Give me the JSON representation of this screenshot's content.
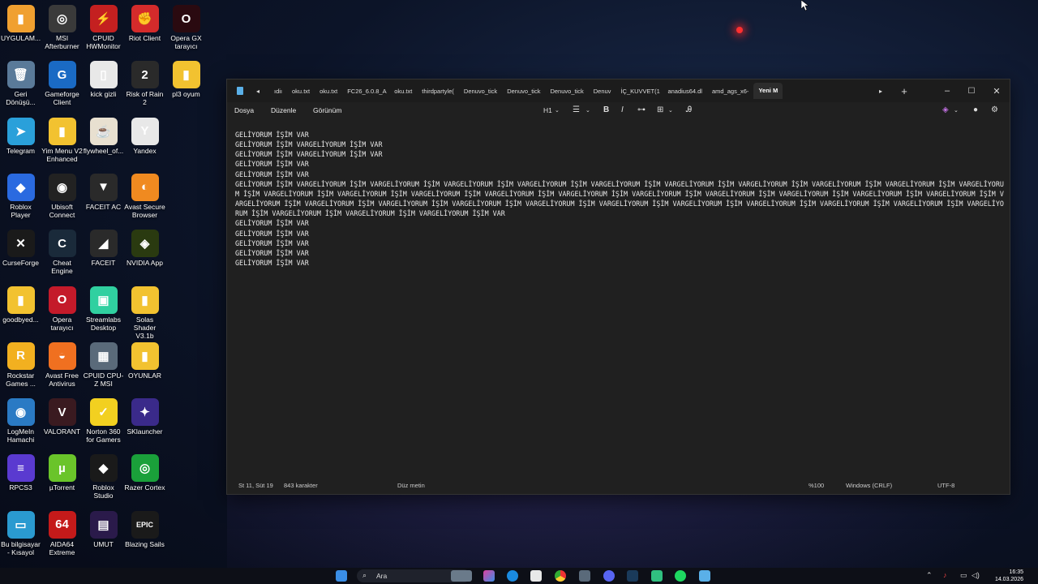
{
  "desktop": {
    "icons": [
      {
        "label": "UYGULAM...",
        "color": "#f0a030",
        "glyph": "▮",
        "col": 0,
        "row": 0
      },
      {
        "label": "MSI Afterburner",
        "color": "#3a3a3a",
        "glyph": "◎",
        "col": 1,
        "row": 0
      },
      {
        "label": "CPUID HWMonitor",
        "color": "#c42020",
        "glyph": "⚡",
        "col": 2,
        "row": 0
      },
      {
        "label": "Riot Client",
        "color": "#d42b2b",
        "glyph": "✊",
        "col": 3,
        "row": 0
      },
      {
        "label": "Opera GX tarayıcı",
        "color": "#2a0a10",
        "glyph": "O",
        "col": 4,
        "row": 0
      },
      {
        "label": "Geri Dönüşü...",
        "color": "#5a7a99",
        "glyph": "🗑",
        "col": 0,
        "row": 1
      },
      {
        "label": "Gameforge Client",
        "color": "#1a6ac4",
        "glyph": "G",
        "col": 1,
        "row": 1
      },
      {
        "label": "kick gizli",
        "color": "#e8e8e8",
        "glyph": "▯",
        "col": 2,
        "row": 1
      },
      {
        "label": "Risk of Rain 2",
        "color": "#2a2a2a",
        "glyph": "2",
        "col": 3,
        "row": 1
      },
      {
        "label": "pl3 oyum",
        "color": "#f2c230",
        "glyph": "▮",
        "col": 4,
        "row": 1
      },
      {
        "label": "Telegram",
        "color": "#2aa0da",
        "glyph": "➤",
        "col": 0,
        "row": 2
      },
      {
        "label": "Yim Menu V2 Enhanced",
        "color": "#f2c230",
        "glyph": "▮",
        "col": 1,
        "row": 2
      },
      {
        "label": "flywheel_of...",
        "color": "#e8e0d0",
        "glyph": "☕",
        "col": 2,
        "row": 2
      },
      {
        "label": "Yandex",
        "color": "#e8e8e8",
        "glyph": "Y",
        "col": 3,
        "row": 2
      },
      {
        "label": "Roblox Player",
        "color": "#2a6ae0",
        "glyph": "◆",
        "col": 0,
        "row": 3
      },
      {
        "label": "Ubisoft Connect",
        "color": "#222",
        "glyph": "◉",
        "col": 1,
        "row": 3
      },
      {
        "label": "FACEIT AC",
        "color": "#2a2a2a",
        "glyph": "▼",
        "col": 2,
        "row": 3
      },
      {
        "label": "Avast Secure Browser",
        "color": "#f08a20",
        "glyph": "◐",
        "col": 3,
        "row": 3
      },
      {
        "label": "CurseForge",
        "color": "#1a1a1a",
        "glyph": "✕",
        "col": 0,
        "row": 4
      },
      {
        "label": "Cheat Engine",
        "color": "#1a2a3a",
        "glyph": "C",
        "col": 1,
        "row": 4
      },
      {
        "label": "FACEIT",
        "color": "#2a2a2a",
        "glyph": "◢",
        "col": 2,
        "row": 4
      },
      {
        "label": "NVIDIA App",
        "color": "#2a3a10",
        "glyph": "◈",
        "col": 3,
        "row": 4
      },
      {
        "label": "goodbyed...",
        "color": "#f2c230",
        "glyph": "▮",
        "col": 0,
        "row": 5
      },
      {
        "label": "Opera tarayıcı",
        "color": "#c41a2a",
        "glyph": "O",
        "col": 1,
        "row": 5
      },
      {
        "label": "Streamlabs Desktop",
        "color": "#30d0a0",
        "glyph": "▣",
        "col": 2,
        "row": 5
      },
      {
        "label": "Solas Shader V3.1b",
        "color": "#f2c230",
        "glyph": "▮",
        "col": 3,
        "row": 5
      },
      {
        "label": "Rockstar Games ...",
        "color": "#f2b020",
        "glyph": "R",
        "col": 0,
        "row": 6
      },
      {
        "label": "Avast Free Antivirus",
        "color": "#f07020",
        "glyph": "◒",
        "col": 1,
        "row": 6
      },
      {
        "label": "CPUID CPU-Z MSI",
        "color": "#5a6a7a",
        "glyph": "▦",
        "col": 2,
        "row": 6
      },
      {
        "label": "OYUNLAR",
        "color": "#f2c230",
        "glyph": "▮",
        "col": 3,
        "row": 6
      },
      {
        "label": "LogMeIn Hamachi",
        "color": "#2a7ac4",
        "glyph": "◉",
        "col": 0,
        "row": 7
      },
      {
        "label": "VALORANT",
        "color": "#3a1a20",
        "glyph": "V",
        "col": 1,
        "row": 7
      },
      {
        "label": "Norton 360 for Gamers",
        "color": "#f2d020",
        "glyph": "✓",
        "col": 2,
        "row": 7
      },
      {
        "label": "SKlauncher",
        "color": "#3a2a8a",
        "glyph": "✦",
        "col": 3,
        "row": 7
      },
      {
        "label": "RPCS3",
        "color": "#5a3ad0",
        "glyph": "≡",
        "col": 0,
        "row": 8
      },
      {
        "label": "µTorrent",
        "color": "#6ac42a",
        "glyph": "µ",
        "col": 1,
        "row": 8
      },
      {
        "label": "Roblox Studio",
        "color": "#1a1a1a",
        "glyph": "◆",
        "col": 2,
        "row": 8
      },
      {
        "label": "Razer Cortex",
        "color": "#1aa03a",
        "glyph": "◎",
        "col": 3,
        "row": 8
      },
      {
        "label": "Bu bilgisayar - Kısayol",
        "color": "#2a9ad0",
        "glyph": "▭",
        "col": 0,
        "row": 9
      },
      {
        "label": "AIDA64 Extreme",
        "color": "#c41a1a",
        "glyph": "64",
        "col": 1,
        "row": 9
      },
      {
        "label": "UMUT",
        "color": "#2a1a4a",
        "glyph": "▤",
        "col": 2,
        "row": 9
      },
      {
        "label": "Blazing Sails",
        "color": "#1a1a1a",
        "glyph": "EPIC",
        "col": 3,
        "row": 9
      }
    ]
  },
  "notepad": {
    "tabs": [
      "ıdiı",
      "oku.txt",
      "oku.txt",
      "FC26_6.0.8_A",
      "oku.txt",
      "thirdpartyle(",
      "Denuvo_tick",
      "Denuvo_tick",
      "Denuvo_tick",
      "Denuv",
      "İÇ_KUVVET(1",
      "anadius64.dl",
      "amd_ags_x6-",
      "Yeni M"
    ],
    "menu": {
      "file": "Dosya",
      "edit": "Düzenle",
      "view": "Görünüm"
    },
    "format": {
      "heading": "H1",
      "bold": "B",
      "italic": "I"
    },
    "content": "GELİYORUM İŞİM VAR\nGELİYORUM İŞİM VARGELİYORUM İŞİM VAR\nGELİYORUM İŞİM VARGELİYORUM İŞİM VAR\nGELİYORUM İŞİM VAR\nGELİYORUM İŞİM VAR\nGELİYORUM İŞİM VARGELİYORUM İŞİM VARGELİYORUM İŞİM VARGELİYORUM İŞİM VARGELİYORUM İŞİM VARGELİYORUM İŞİM VARGELİYORUM İŞİM VARGELİYORUM İŞİM VARGELİYORUM İŞİM VARGELİYORUM İŞİM VARGELİYORUM İŞİM VARGELİYORUM İŞİM VARGELİYORUM İŞİM VARGELİYORUM İŞİM VARGELİYORUM İŞİM VARGELİYORUM İŞİM VARGELİYORUM İŞİM VARGELİYORUM İŞİM VARGELİYORUM İŞİM VARGELİYORUM İŞİM VARGELİYORUM İŞİM VARGELİYORUM İŞİM VARGELİYORUM İŞİM VARGELİYORUM İŞİM VARGELİYORUM İŞİM VARGELİYORUM İŞİM VARGELİYORUM İŞİM VARGELİYORUM İŞİM VARGELİYORUM İŞİM VARGELİYORUM İŞİM VARGELİYORUM İŞİM VARGELİYORUM İŞİM VARGELİYORUM İŞİM VARGELİYORUM İŞİM VARGELİYORUM İŞİM VAR\nGELİYORUM İŞİM VAR\nGELİYORUM İŞİM VAR\nGELİYORUM İŞİM VAR\nGELİYORUM İŞİM VAR\nGELİYORUM İŞİM VAR",
    "status": {
      "position": "St 11, Süt 19",
      "chars": "843 karakter",
      "mode": "Düz metin",
      "zoom": "%100",
      "eol": "Windows (CRLF)",
      "encoding": "UTF-8"
    }
  },
  "taskbar": {
    "search_placeholder": "Ara",
    "time": "16:35",
    "date": "14.03.2026"
  },
  "colors": {
    "accent": "#3a8ee6",
    "window_bg": "#202020",
    "taskbar_bg": "#0d0f17"
  }
}
